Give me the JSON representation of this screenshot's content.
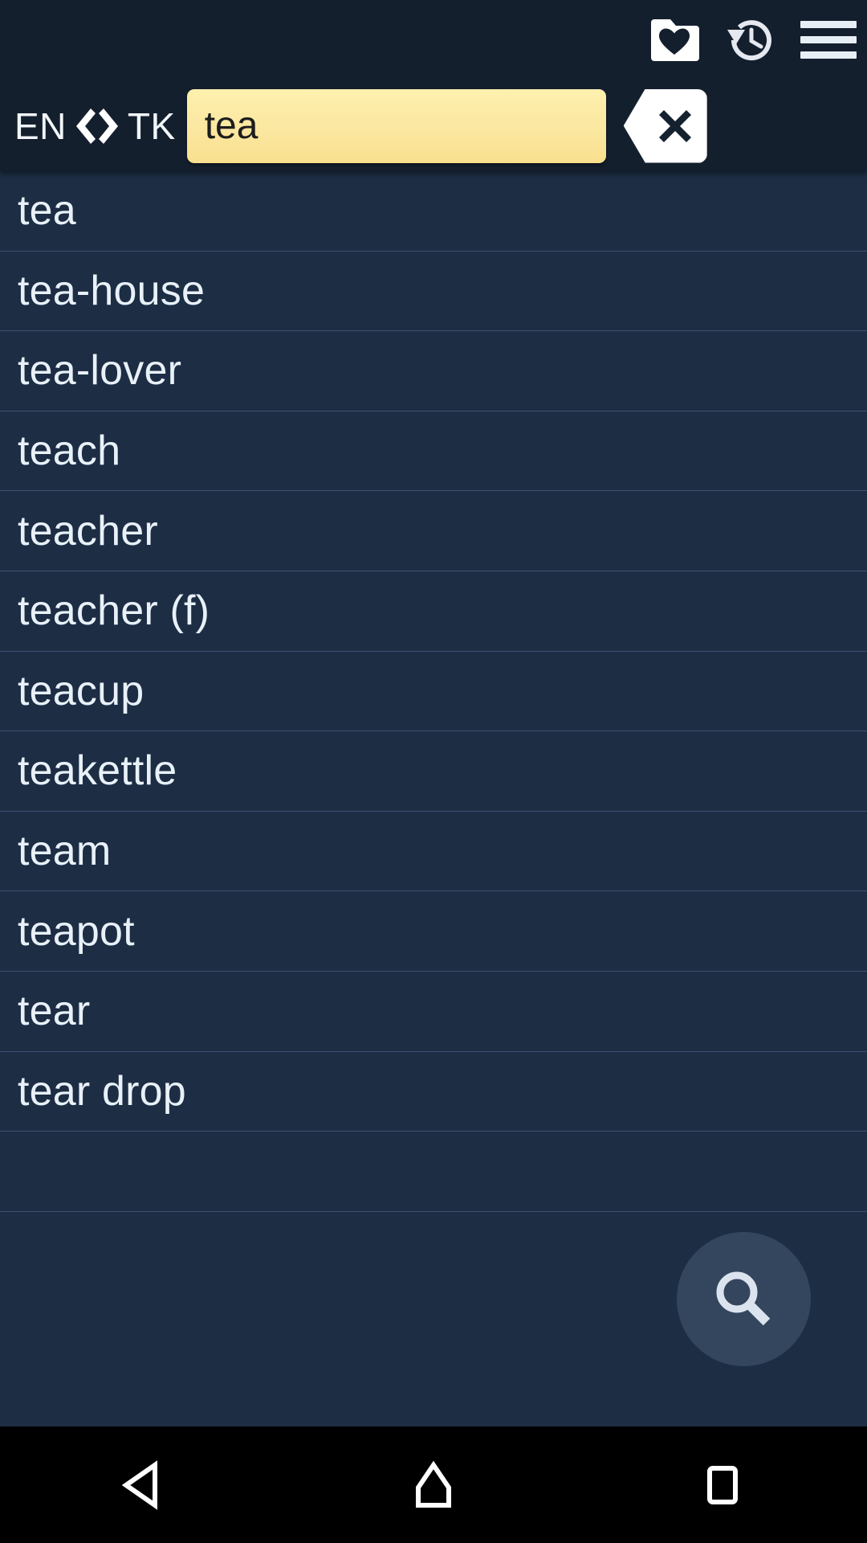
{
  "header": {
    "icons": [
      {
        "name": "favorites-folder-icon",
        "label": "Favourites"
      },
      {
        "name": "history-icon",
        "label": "History"
      },
      {
        "name": "menu-icon",
        "label": "Menu"
      }
    ],
    "language": {
      "source": "EN",
      "target": "TK",
      "swap_label": "❮ ❯"
    },
    "search": {
      "value": "tea",
      "placeholder": "",
      "clear_label": "✕"
    }
  },
  "results": {
    "items": [
      {
        "word": "tea"
      },
      {
        "word": "tea-house"
      },
      {
        "word": "tea-lover"
      },
      {
        "word": "teach"
      },
      {
        "word": "teacher"
      },
      {
        "word": "teacher (f)"
      },
      {
        "word": "teacup"
      },
      {
        "word": "teakettle"
      },
      {
        "word": "team"
      },
      {
        "word": "teapot"
      },
      {
        "word": "tear"
      },
      {
        "word": "tear drop"
      },
      {
        "word": ""
      }
    ]
  },
  "fab": {
    "name": "search-fab",
    "label": "Search"
  },
  "navbar": {
    "buttons": [
      {
        "name": "nav-back",
        "label": "Back"
      },
      {
        "name": "nav-home",
        "label": "Home"
      },
      {
        "name": "nav-recents",
        "label": "Recents"
      }
    ]
  },
  "colors": {
    "header_bg": "#141f2e",
    "list_bg": "#1d2d44",
    "separator": "#3c5270",
    "text": "#e8f1f8",
    "search_field_bg": "#fbe7a0",
    "search_text": "#1d1d1d",
    "navbar_bg": "#000000",
    "fab_bg": "rgba(176,201,230,0.16)"
  }
}
